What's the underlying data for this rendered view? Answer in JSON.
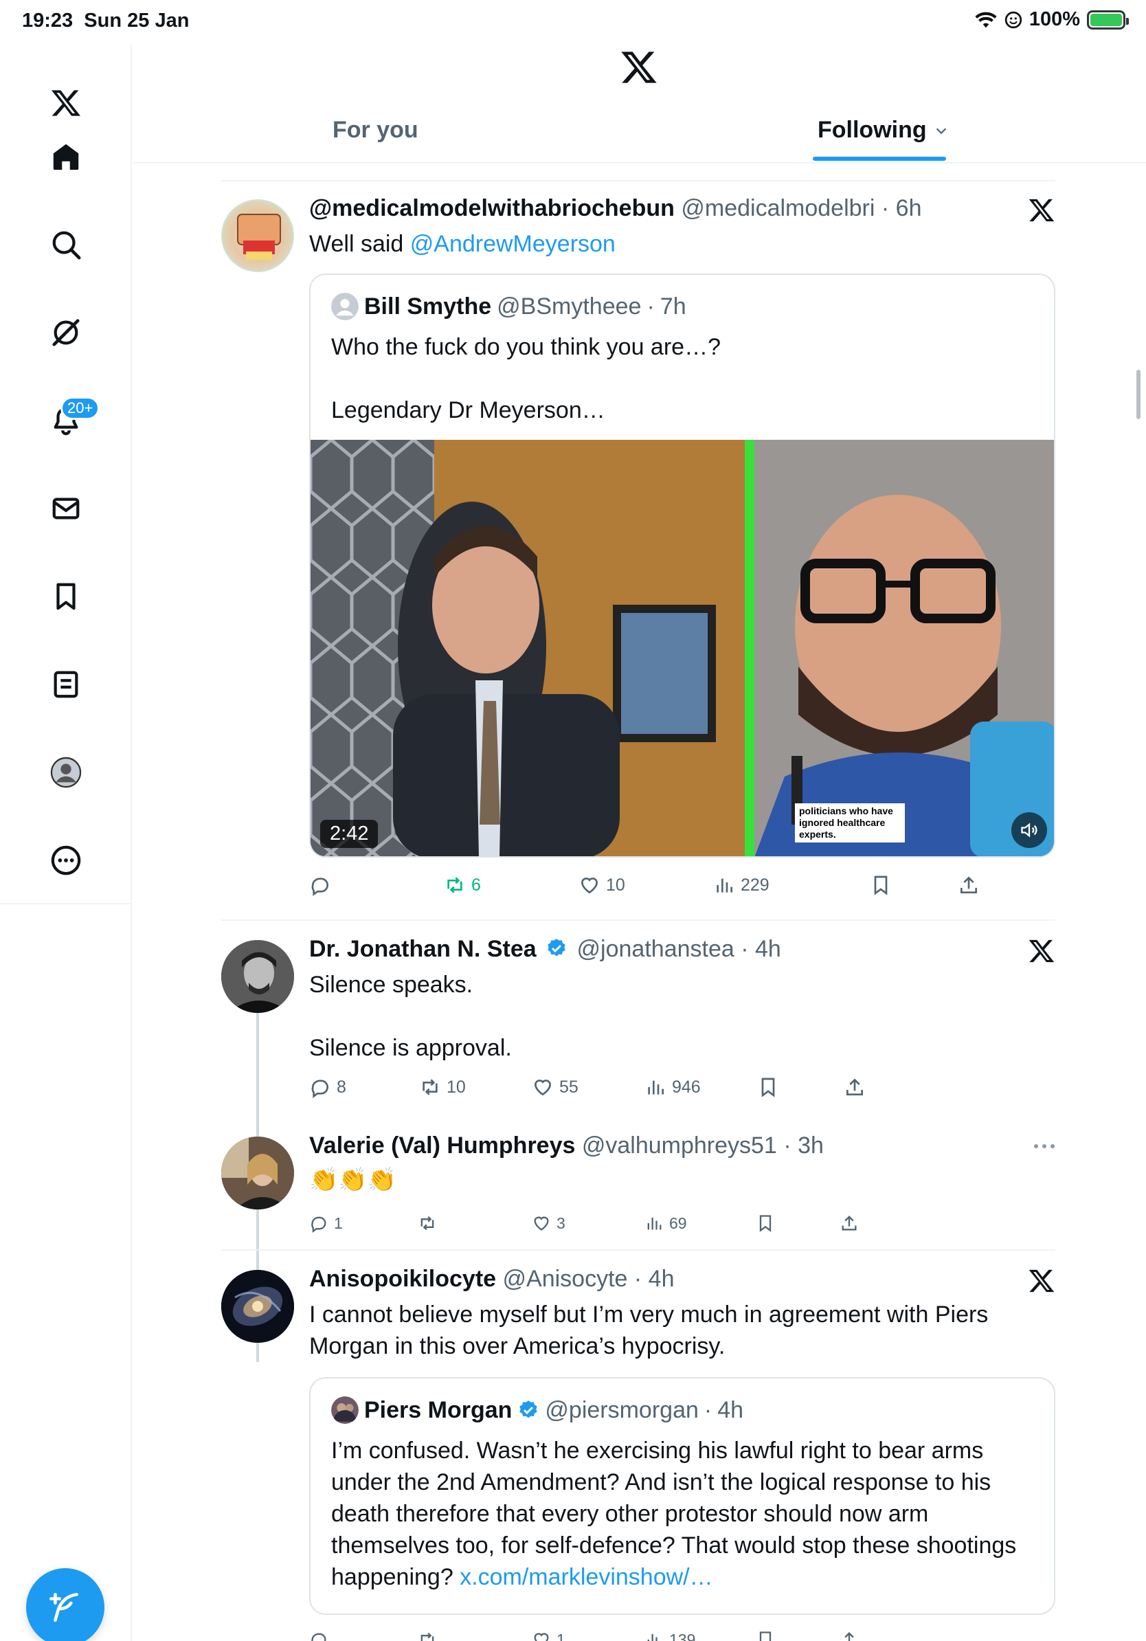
{
  "status_bar": {
    "time": "19:23",
    "date": "Sun 25 Jan",
    "battery": "100%"
  },
  "sidebar": {
    "items": [
      {
        "name": "home",
        "icon": "home-icon"
      },
      {
        "name": "explore",
        "icon": "search-icon"
      },
      {
        "name": "grok",
        "icon": "grok-icon"
      },
      {
        "name": "notifications",
        "icon": "bell-icon"
      },
      {
        "name": "messages",
        "icon": "mail-icon"
      },
      {
        "name": "bookmarks",
        "icon": "bookmark-icon"
      },
      {
        "name": "lists",
        "icon": "list-icon"
      },
      {
        "name": "profile",
        "icon": "avatar-icon"
      },
      {
        "name": "more",
        "icon": "more-icon"
      }
    ],
    "notifications_badge": "20+"
  },
  "header": {
    "tabs": [
      {
        "label": "For you",
        "active": false
      },
      {
        "label": "Following",
        "active": true
      }
    ]
  },
  "colors": {
    "accent": "#1d9bf0",
    "repost_green": "#00ba7c",
    "text": "#0f1419",
    "muted": "#536471"
  },
  "posts": [
    {
      "name": "@medicalmodelwithabriochebun",
      "handle": "@medicalmodelbri",
      "time": "6h",
      "text_prefix": "Well said ",
      "mention": "@AndrewMeyerson",
      "quote": {
        "name": "Bill Smythe",
        "handle": "@BSmytheee",
        "time": "7h",
        "line1": "Who the fuck do you think you are…?",
        "line2": "Legendary Dr Meyerson…",
        "video_duration": "2:42",
        "video_caption": "politicians who have ignored healthcare experts."
      },
      "stats": {
        "replies": "",
        "reposts": "6",
        "likes": "10",
        "views": "229"
      }
    },
    {
      "name": "Dr. Jonathan N. Stea",
      "handle": "@jonathanstea",
      "time": "4h",
      "line1": "Silence speaks.",
      "line2": "Silence is approval.",
      "stats": {
        "replies": "8",
        "reposts": "10",
        "likes": "55",
        "views": "946"
      }
    },
    {
      "name": "Valerie (Val) Humphreys",
      "handle": "@valhumphreys51",
      "time": "3h",
      "text": "👏👏👏",
      "stats": {
        "replies": "1",
        "reposts": "",
        "likes": "3",
        "views": "69"
      }
    },
    {
      "name": "Anisopoikilocyte",
      "handle": "@Anisocyte",
      "time": "4h",
      "line1": "I cannot believe myself but I’m very much in agreement with Piers",
      "line2": "Morgan in this over America’s hypocrisy.",
      "quote": {
        "name": "Piers Morgan",
        "handle": "@piersmorgan",
        "time": "4h",
        "lines": [
          "I’m confused. Wasn’t he exercising his lawful right to bear arms",
          "under the 2nd Amendment? And isn’t the logical response to his",
          "death therefore that every other protestor should now arm",
          "themselves too, for self-defence? That would stop these shootings"
        ],
        "last_line_text": "happening? ",
        "link": "x.com/marklevinshow/…"
      },
      "stats": {
        "replies": "",
        "reposts": "",
        "likes": "1",
        "views": "139"
      }
    }
  ]
}
